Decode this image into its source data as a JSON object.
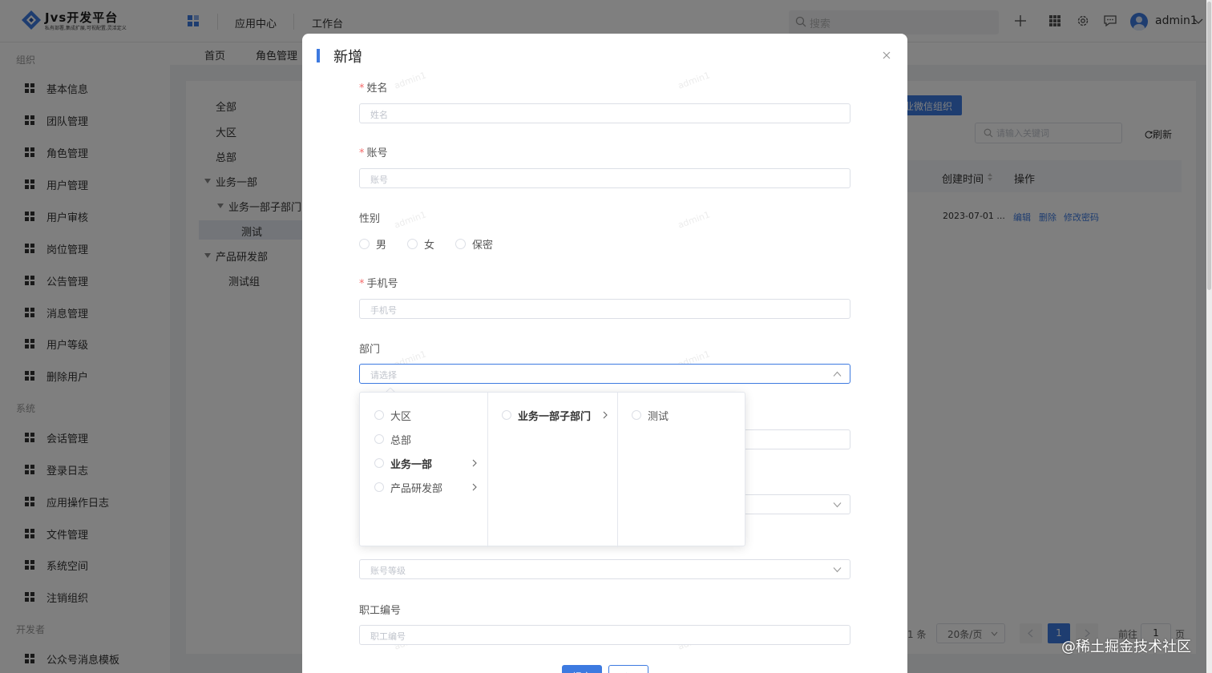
{
  "brand": {
    "title": "Jvs开发平台",
    "subtitle": "私有部署,集成扩展,可视配置,灵活定义",
    "accent_color": "#3d7ae0"
  },
  "topnav": {
    "items": [
      "应用中心",
      "工作台"
    ],
    "search_placeholder": "搜索",
    "icons": [
      "plus-icon",
      "grid-icon",
      "settings-icon",
      "message-icon"
    ],
    "username": "admin1"
  },
  "sidebar": {
    "groups": [
      {
        "title": "组织",
        "items": [
          "基本信息",
          "团队管理",
          "角色管理",
          "用户管理",
          "用户审核",
          "岗位管理",
          "公告管理",
          "消息管理",
          "用户等级",
          "删除用户"
        ]
      },
      {
        "title": "系统",
        "items": [
          "会话管理",
          "登录日志",
          "应用操作日志",
          "文件管理",
          "系统空间",
          "注销组织"
        ]
      },
      {
        "title": "开发者",
        "items": [
          "公众号消息模板"
        ]
      }
    ]
  },
  "tabs": [
    "首页",
    "角色管理"
  ],
  "dept_tree": [
    "全部",
    "大区",
    "总部",
    "业务一部",
    "业务一部子部门",
    "测试",
    "产品研发部",
    "测试组"
  ],
  "toolbar": {
    "wechat_button": "业微信组织",
    "keyword_placeholder": "请输入关键词",
    "refresh_label": "刷新"
  },
  "table": {
    "headers": [
      "创建时间",
      "操作"
    ],
    "row": {
      "created": "2023-07-01 ...",
      "actions": [
        "编辑",
        "删除",
        "修改密码"
      ]
    }
  },
  "pagination": {
    "total_suffix": "1 条",
    "page_size": "20条/页",
    "current_page": "1",
    "goto_label": "前往",
    "goto_value": "1",
    "page_suffix": "页"
  },
  "dialog": {
    "title": "新增",
    "watermark": "admin1",
    "fields": {
      "name": {
        "label": "姓名",
        "placeholder": "姓名"
      },
      "account": {
        "label": "账号",
        "placeholder": "账号"
      },
      "gender": {
        "label": "性别",
        "options": [
          "男",
          "女",
          "保密"
        ]
      },
      "phone": {
        "label": "手机号",
        "placeholder": "手机号"
      },
      "dept": {
        "label": "部门",
        "placeholder": "请选择"
      },
      "level": {
        "placeholder": "账号等级"
      },
      "employee_no": {
        "label": "职工编号",
        "placeholder": "职工编号"
      }
    },
    "buttons": {
      "submit": "提交",
      "reset": "重置"
    }
  },
  "cascader": {
    "columns": [
      [
        {
          "label": "大区",
          "has_children": false
        },
        {
          "label": "总部",
          "has_children": false
        },
        {
          "label": "业务一部",
          "has_children": true,
          "active": true
        },
        {
          "label": "产品研发部",
          "has_children": true
        }
      ],
      [
        {
          "label": "业务一部子部门",
          "has_children": true,
          "active": true
        }
      ],
      [
        {
          "label": "测试",
          "has_children": false
        }
      ]
    ]
  },
  "footer_watermark": "@稀土掘金技术社区"
}
